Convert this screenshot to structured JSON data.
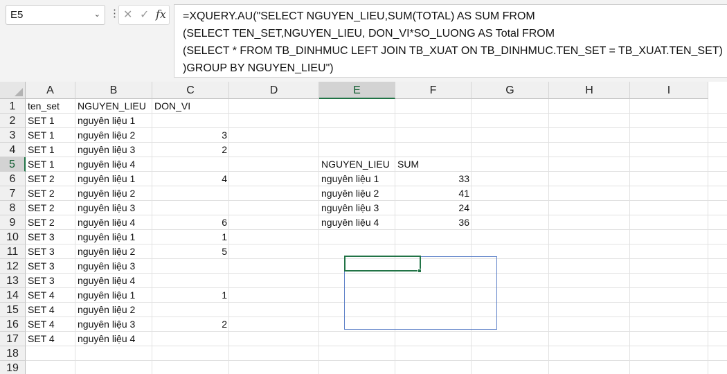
{
  "name_box": {
    "value": "E5"
  },
  "icons": {
    "namebox_dropdown": "chevron-down-icon",
    "more": "kebab-icon",
    "cancel": "close-icon",
    "enter": "checkmark-icon",
    "function": "fx-icon"
  },
  "formula_bar": {
    "lines": [
      "=XQUERY.AU(\"SELECT NGUYEN_LIEU,SUM(TOTAL) AS SUM FROM",
      "(SELECT TEN_SET,NGUYEN_LIEU, DON_VI*SO_LUONG AS Total FROM",
      "(SELECT * FROM TB_DINHMUC LEFT JOIN TB_XUAT ON TB_DINHMUC.TEN_SET = TB_XUAT.TEN_SET)",
      ")GROUP BY NGUYEN_LIEU\")"
    ]
  },
  "columns": [
    "A",
    "B",
    "C",
    "D",
    "E",
    "F",
    "G",
    "H",
    "I"
  ],
  "rows": [
    "1",
    "2",
    "3",
    "4",
    "5",
    "6",
    "7",
    "8",
    "9",
    "10",
    "11",
    "12",
    "13",
    "14",
    "15",
    "16",
    "17",
    "18",
    "19"
  ],
  "selected": {
    "column": "E",
    "row": "5"
  },
  "colors": {
    "accent": "#217346",
    "table_border": "#5b7fc7"
  },
  "sheet": {
    "A": [
      "ten_set",
      "SET 1",
      "SET 1",
      "SET 1",
      "SET 1",
      "SET 2",
      "SET 2",
      "SET 2",
      "SET 2",
      "SET 3",
      "SET 3",
      "SET 3",
      "SET 3",
      "SET 4",
      "SET 4",
      "SET 4",
      "SET 4"
    ],
    "B": [
      "NGUYEN_LIEU",
      "nguyên liệu 1",
      "nguyên liệu 2",
      "nguyên liệu 3",
      "nguyên liệu 4",
      "nguyên liệu 1",
      "nguyên liệu 2",
      "nguyên liệu 3",
      "nguyên liệu 4",
      "nguyên liệu 1",
      "nguyên liệu 2",
      "nguyên liệu 3",
      "nguyên liệu 4",
      "nguyên liệu 1",
      "nguyên liệu 2",
      "nguyên liệu 3",
      "nguyên liệu 4"
    ],
    "C": [
      "DON_VI",
      "",
      "3",
      "2",
      "",
      "4",
      "",
      "",
      "6",
      "1",
      "5",
      "",
      "",
      "1",
      "",
      "2",
      ""
    ]
  },
  "result": {
    "headers": [
      "NGUYEN_LIEU",
      "SUM"
    ],
    "rows": [
      [
        "nguyên liệu 1",
        "33"
      ],
      [
        "nguyên liệu 2",
        "41"
      ],
      [
        "nguyên liệu 3",
        "24"
      ],
      [
        "nguyên liệu 4",
        "36"
      ]
    ]
  }
}
